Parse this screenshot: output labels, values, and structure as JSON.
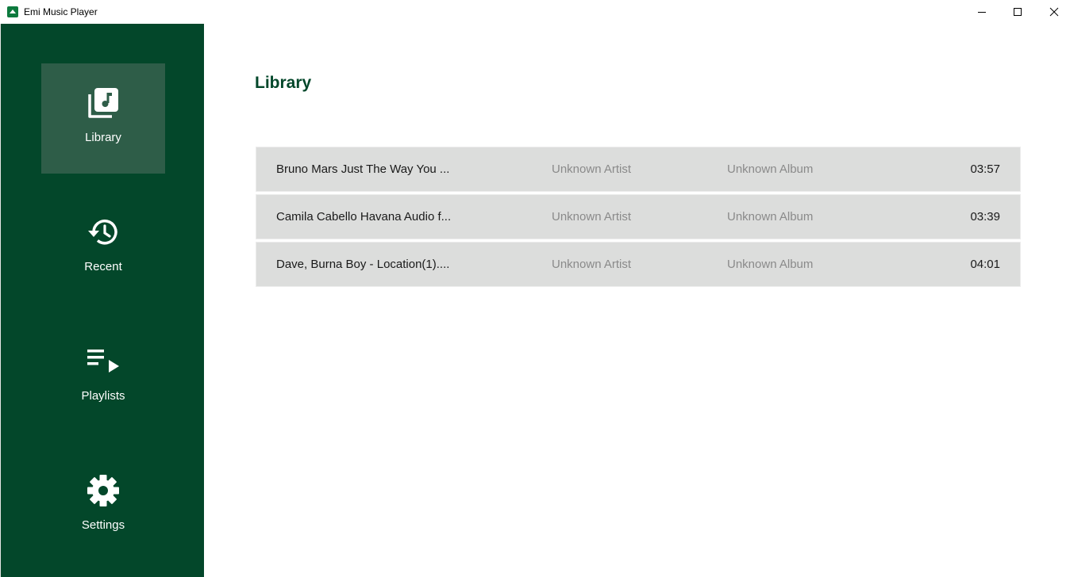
{
  "window": {
    "title": "Emi Music Player"
  },
  "sidebar": {
    "items": [
      {
        "label": "Library",
        "icon": "library-music-icon",
        "active": true
      },
      {
        "label": "Recent",
        "icon": "history-icon",
        "active": false
      },
      {
        "label": "Playlists",
        "icon": "playlist-play-icon",
        "active": false
      },
      {
        "label": "Settings",
        "icon": "gear-icon",
        "active": false
      }
    ]
  },
  "main": {
    "title": "Library",
    "tracks": [
      {
        "title": "Bruno Mars  Just The Way You ...",
        "artist": "Unknown Artist",
        "album": "Unknown Album",
        "duration": "03:57"
      },
      {
        "title": "Camila Cabello  Havana Audio f...",
        "artist": "Unknown Artist",
        "album": "Unknown Album",
        "duration": "03:39"
      },
      {
        "title": "Dave, Burna Boy - Location(1)....",
        "artist": "Unknown Artist",
        "album": "Unknown Album",
        "duration": "04:01"
      }
    ]
  },
  "colors": {
    "sidebar_bg": "#03472a",
    "sidebar_active": "#2e5d48",
    "accent_text": "#03472a",
    "row_bg": "#dcdddc"
  }
}
